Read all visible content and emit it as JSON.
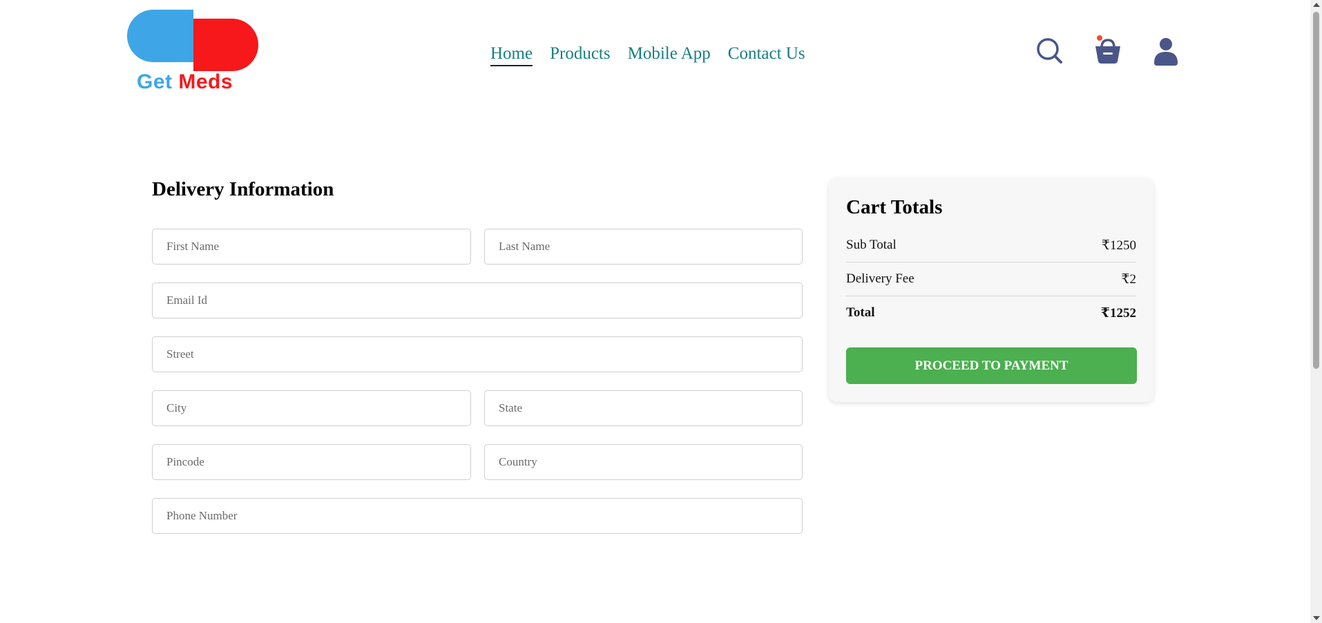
{
  "brand": {
    "part1": "Get",
    "part2": "Meds",
    "colors": {
      "blue": "#3ea6e6",
      "red": "#f7181b"
    }
  },
  "nav": {
    "items": [
      {
        "label": "Home",
        "active": true
      },
      {
        "label": "Products"
      },
      {
        "label": "Mobile App"
      },
      {
        "label": "Contact Us"
      }
    ]
  },
  "header_icons": [
    "search-icon",
    "basket-icon",
    "user-icon"
  ],
  "delivery": {
    "title": "Delivery Information",
    "fields": {
      "first_name": "First Name",
      "last_name": "Last Name",
      "email": "Email Id",
      "street": "Street",
      "city": "City",
      "state": "State",
      "pincode": "Pincode",
      "country": "Country",
      "phone": "Phone Number"
    }
  },
  "cart": {
    "title": "Cart Totals",
    "subtotal_label": "Sub Total",
    "subtotal_value": "₹1250",
    "delivery_label": "Delivery Fee",
    "delivery_value": "₹2",
    "total_label": "Total",
    "total_value": "₹1252",
    "button": "PROCEED TO PAYMENT"
  },
  "colors": {
    "nav_link": "#177f82",
    "button": "#4caf50",
    "icon": "#4a5688",
    "cart_badge": "#f24b3c"
  }
}
